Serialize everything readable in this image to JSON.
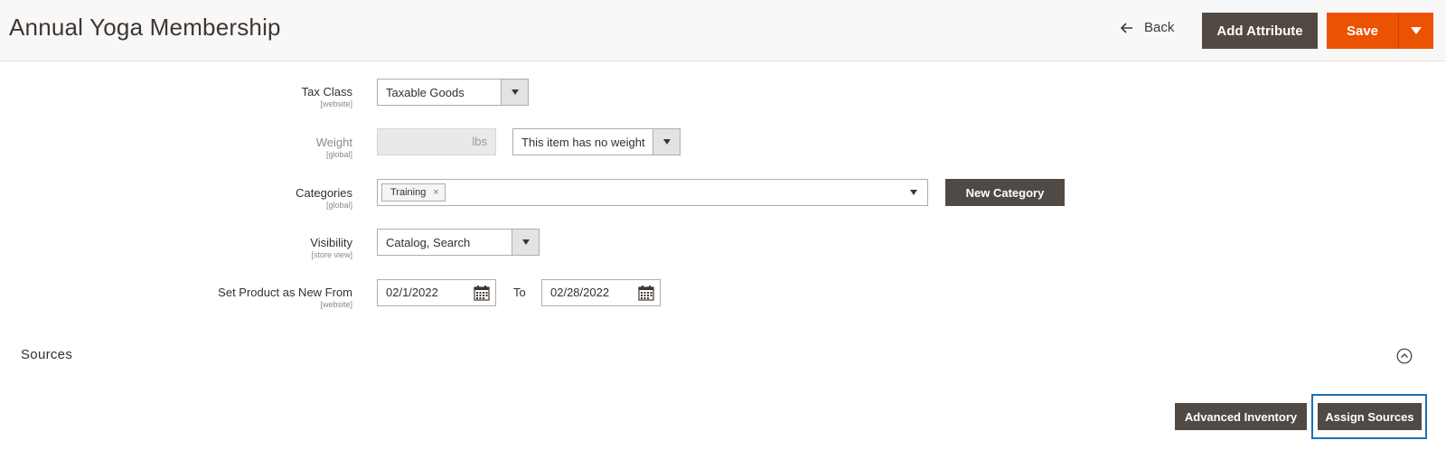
{
  "header": {
    "title": "Annual Yoga Membership",
    "back_label": "Back",
    "add_attribute_label": "Add Attribute",
    "save_label": "Save"
  },
  "form": {
    "tax_class": {
      "label": "Tax Class",
      "scope": "[website]",
      "value": "Taxable Goods"
    },
    "weight": {
      "label": "Weight",
      "scope": "[global]",
      "unit": "lbs",
      "value": "",
      "type_value": "This item has no weight"
    },
    "categories": {
      "label": "Categories",
      "scope": "[global]",
      "tags": [
        "Training"
      ],
      "new_category_label": "New Category"
    },
    "visibility": {
      "label": "Visibility",
      "scope": "[store view]",
      "value": "Catalog, Search"
    },
    "new_from": {
      "label": "Set Product as New From",
      "scope": "[website]",
      "from_value": "02/1/2022",
      "to_label": "To",
      "to_value": "02/28/2022"
    }
  },
  "sources": {
    "title": "Sources",
    "advanced_inventory_label": "Advanced Inventory",
    "assign_sources_label": "Assign Sources"
  },
  "colors": {
    "primary_dark": "#514943",
    "save_orange": "#eb5202",
    "highlight_blue": "#1f6fb2"
  }
}
